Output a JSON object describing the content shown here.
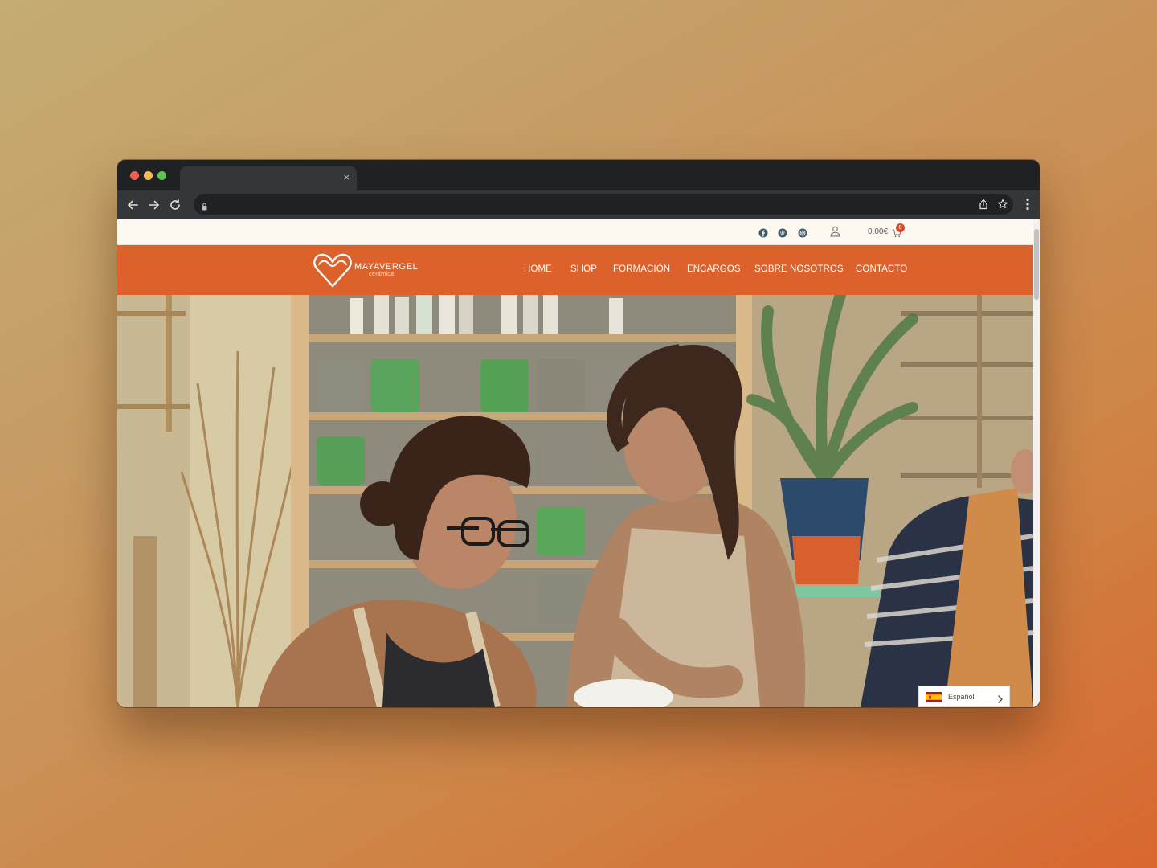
{
  "browser": {
    "tab_close": "×",
    "icons": [
      "back-arrow-icon",
      "forward-arrow-icon",
      "reload-icon",
      "lock-icon",
      "share-icon",
      "bookmark-star-icon",
      "kebab-menu-icon"
    ]
  },
  "topbar": {
    "socials": [
      "facebook-icon",
      "pinterest-icon",
      "instagram-icon"
    ],
    "account_icon": "user-icon",
    "cart_amount": "0,00€",
    "cart_count": "0"
  },
  "brand": {
    "name": "MAYAVERGEL",
    "tagline": "cerámica"
  },
  "nav": {
    "items": [
      "HOME",
      "SHOP",
      "FORMACIÓN",
      "ENCARGOS",
      "SOBRE NOSOTROS",
      "CONTACTO"
    ]
  },
  "language_switcher": {
    "label": "Español",
    "flag": "spain-flag-icon"
  },
  "colors": {
    "brand_orange": "#dc612b",
    "topbar_bg": "#fdf9f1",
    "browser_chrome": "#202124",
    "cart_badge": "#d64a2b"
  }
}
